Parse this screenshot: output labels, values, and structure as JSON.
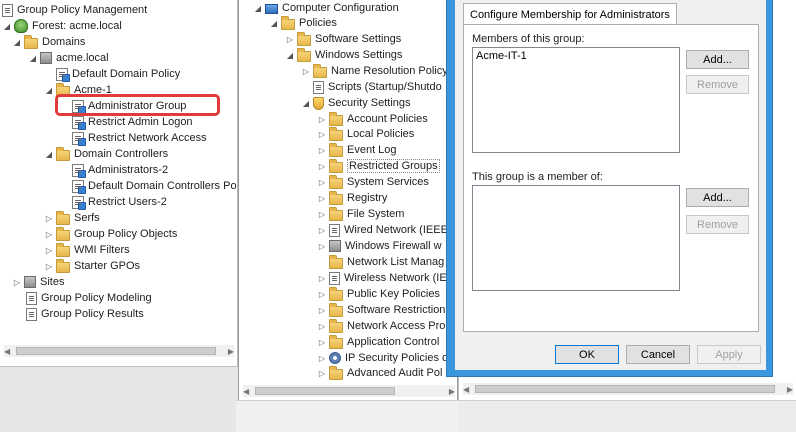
{
  "gpmc": {
    "tree": [
      {
        "label": "Group Policy Management",
        "icon": "gpm-icon"
      },
      {
        "label": "Forest: acme.local",
        "icon": "forest-icon"
      },
      {
        "label": "Domains",
        "icon": "folder-icon"
      },
      {
        "label": "acme.local",
        "icon": "domain-icon"
      },
      {
        "label": "Default Domain Policy",
        "icon": "gpo-link-icon"
      },
      {
        "label": "Acme-1",
        "icon": "ou-icon"
      },
      {
        "label": "Administrator Group",
        "icon": "gpo-link-icon"
      },
      {
        "label": "Restrict Admin Logon",
        "icon": "gpo-link-icon"
      },
      {
        "label": "Restrict Network Access",
        "icon": "gpo-link-icon"
      },
      {
        "label": "Domain Controllers",
        "icon": "ou-icon"
      },
      {
        "label": "Administrators-2",
        "icon": "gpo-link-icon"
      },
      {
        "label": "Default Domain Controllers Po",
        "icon": "gpo-link-icon"
      },
      {
        "label": "Restrict Users-2",
        "icon": "gpo-link-icon"
      },
      {
        "label": "Serfs",
        "icon": "ou-icon"
      },
      {
        "label": "Group Policy Objects",
        "icon": "folder-icon"
      },
      {
        "label": "WMI Filters",
        "icon": "folder-icon"
      },
      {
        "label": "Starter GPOs",
        "icon": "folder-icon"
      },
      {
        "label": "Sites",
        "icon": "sites-icon"
      },
      {
        "label": "Group Policy Modeling",
        "icon": "modeling-icon"
      },
      {
        "label": "Group Policy Results",
        "icon": "results-icon"
      }
    ]
  },
  "gpme": {
    "tree": [
      {
        "label": "Computer Configuration",
        "icon": "computer-icon"
      },
      {
        "label": "Policies",
        "icon": "folder-icon"
      },
      {
        "label": "Software Settings",
        "icon": "folder-icon"
      },
      {
        "label": "Windows Settings",
        "icon": "folder-icon"
      },
      {
        "label": "Name Resolution Policy",
        "icon": "folder-icon"
      },
      {
        "label": "Scripts (Startup/Shutdo",
        "icon": "scripts-icon"
      },
      {
        "label": "Security Settings",
        "icon": "security-icon"
      },
      {
        "label": "Account Policies",
        "icon": "folder-icon"
      },
      {
        "label": "Local Policies",
        "icon": "folder-icon"
      },
      {
        "label": "Event Log",
        "icon": "folder-icon"
      },
      {
        "label": "Restricted Groups",
        "icon": "folder-icon"
      },
      {
        "label": "System Services",
        "icon": "folder-icon"
      },
      {
        "label": "Registry",
        "icon": "folder-icon"
      },
      {
        "label": "File System",
        "icon": "folder-icon"
      },
      {
        "label": "Wired Network (IEEE",
        "icon": "wired-network-icon"
      },
      {
        "label": "Windows Firewall w",
        "icon": "firewall-icon"
      },
      {
        "label": "Network List Manag",
        "icon": "folder-icon"
      },
      {
        "label": "Wireless Network (IE",
        "icon": "wireless-network-icon"
      },
      {
        "label": "Public Key Policies",
        "icon": "folder-icon"
      },
      {
        "label": "Software Restriction",
        "icon": "folder-icon"
      },
      {
        "label": "Network Access Pro",
        "icon": "folder-icon"
      },
      {
        "label": "Application Control",
        "icon": "folder-icon"
      },
      {
        "label": "IP Security Policies o",
        "icon": "ip-security-icon"
      },
      {
        "label": "Advanced Audit Pol",
        "icon": "folder-icon"
      }
    ]
  },
  "dialog": {
    "tab_label": "Configure Membership for Administrators",
    "members_label": "Members of this group:",
    "members": [
      "Acme-IT-1"
    ],
    "member_of_label": "This group is a member of:",
    "member_of": [],
    "add_label": "Add...",
    "remove_label": "Remove",
    "ok_label": "OK",
    "cancel_label": "Cancel",
    "apply_label": "Apply"
  },
  "colors": {
    "highlight": "#e03a3a",
    "dialog_frame": "#3a96dd"
  }
}
